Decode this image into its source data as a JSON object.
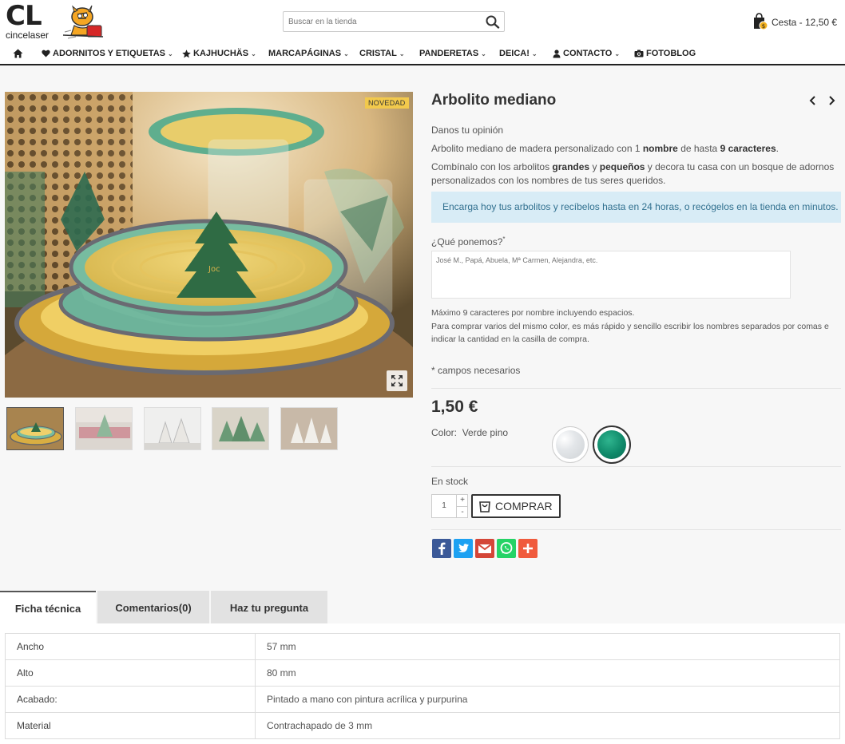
{
  "header": {
    "logo_text": "CL",
    "logo_subtext": "cincelaser",
    "search_placeholder": "Buscar en la tienda",
    "cart_text": "Cesta - 12,50 €"
  },
  "nav": {
    "items": [
      {
        "label": "ADORNITOS Y ETIQUETAS"
      },
      {
        "label": "KAJHUCHÄS"
      },
      {
        "label": "MARCAPÁGINAS"
      },
      {
        "label": "CRISTAL"
      },
      {
        "label": "PANDERETAS"
      },
      {
        "label": "DEICA!"
      },
      {
        "label": "CONTACTO"
      },
      {
        "label": "FOTOBLOG"
      }
    ]
  },
  "product": {
    "badge": "NOVEDAD",
    "title": "Arbolito mediano",
    "review_link": "Danos tu opinión",
    "desc1_a": "Arbolito mediano de madera personalizado con 1 ",
    "desc1_b": "nombre",
    "desc1_c": " de hasta ",
    "desc1_d": "9 caracteres",
    "desc1_e": ".",
    "desc2_a": "Combínalo con los arbolitos ",
    "desc2_b": "grandes",
    "desc2_c": " y ",
    "desc2_d": "pequeños",
    "desc2_e": " y decora tu casa con un bosque de adornos",
    "desc3": "personalizados con los nombres de tus seres queridos.",
    "info_box": "Encarga hoy tus arbolitos y recíbelos hasta en 24 horas, o recógelos en la tienda en minutos.",
    "field_label": "¿Qué ponemos?",
    "field_required_mark": "*",
    "field_placeholder": "José M., Papá, Abuela, Mª Carmen, Alejandra, etc.",
    "note1": "Máximo 9 caracteres por nombre incluyendo espacios.",
    "note2": "Para comprar varios del mismo color, es más rápido y sencillo escribir los nombres separados por comas e",
    "note3": "indicar la cantidad en la casilla de compra.",
    "required_note": "* campos necesarios",
    "price": "1,50 €",
    "color_label": "Color:",
    "color_value": "Verde pino",
    "stock": "En stock",
    "quantity": "1",
    "qty_plus": "+",
    "qty_minus": "-",
    "buy_label": "COMPRAR"
  },
  "colors": {
    "swatch_white": "#e8eaec",
    "swatch_green": "#0f8a6a",
    "info_bg": "#d8ecf6",
    "badge_bg": "#f2c94c"
  },
  "share": [
    {
      "name": "facebook",
      "color": "#3b5998"
    },
    {
      "name": "twitter",
      "color": "#1da1f2"
    },
    {
      "name": "gmail",
      "color": "#d44638"
    },
    {
      "name": "whatsapp",
      "color": "#25d366"
    },
    {
      "name": "more",
      "color": "#f05a3c"
    }
  ],
  "tabs": [
    {
      "label": "Ficha técnica"
    },
    {
      "label": "Comentarios(0)"
    },
    {
      "label": "Haz tu pregunta"
    }
  ],
  "specs": [
    {
      "key": "Ancho",
      "value": "57 mm"
    },
    {
      "key": "Alto",
      "value": "80 mm"
    },
    {
      "key": "Acabado:",
      "value": "Pintado a mano con pintura acrílica y purpurina"
    },
    {
      "key": "Material",
      "value": "Contrachapado de 3 mm"
    }
  ]
}
